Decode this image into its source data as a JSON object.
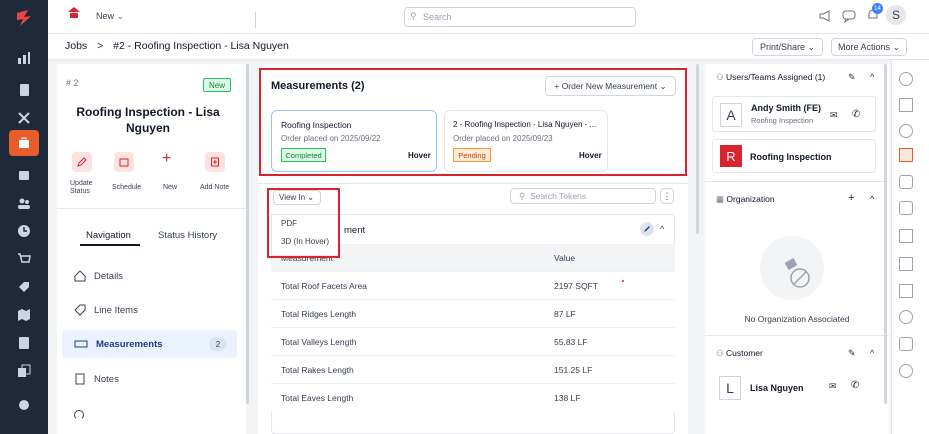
{
  "topbar": {
    "new_label": "New",
    "search_placeholder": "Search",
    "notif_count": "14",
    "avatar_initial": "S"
  },
  "breadcrumb": {
    "root": "Jobs",
    "separator": ">",
    "current": "#2 - Roofing Inspection - Lisa Nguyen"
  },
  "actions": {
    "print_share": "Print/Share",
    "more_actions": "More Actions"
  },
  "job": {
    "number": "# 2",
    "badge": "New",
    "title": "Roofing Inspection - Lisa Nguyen",
    "quick_actions": [
      {
        "label": "Update Status"
      },
      {
        "label": "Schedule"
      },
      {
        "label": "New"
      },
      {
        "label": "Add Note"
      }
    ],
    "tabs": [
      "Navigation",
      "Status History"
    ],
    "nav": [
      {
        "label": "Details"
      },
      {
        "label": "Line Items"
      },
      {
        "label": "Measurements",
        "count": "2"
      },
      {
        "label": "Notes"
      }
    ]
  },
  "measurements": {
    "title": "Measurements (2)",
    "order_button": "+ Order New Measurement",
    "orders": [
      {
        "title": "Roofing Inspection",
        "date": "Order placed on 2025/09/22",
        "status": "Completed",
        "hover": "Hover"
      },
      {
        "title": "2 - Roofing Inspection - Lisa Nguyen - ...",
        "date": "Order placed on 2025/09/23",
        "status": "Pending",
        "hover": "Hover"
      }
    ],
    "view_in": "View In",
    "view_menu": [
      "PDF",
      "3D (In Hover)"
    ],
    "search_tokens": "Search Tokens",
    "section_title_suffix": "ment",
    "table_headers": [
      "Measurement",
      "Value"
    ],
    "rows": [
      {
        "name": "Total Roof Facets Area",
        "value": "2197 SQFT"
      },
      {
        "name": "Total Ridges Length",
        "value": "87 LF"
      },
      {
        "name": "Total Valleys Length",
        "value": "55.83 LF"
      },
      {
        "name": "Total Rakes Length",
        "value": "151.25 LF"
      },
      {
        "name": "Total Eaves Length",
        "value": "138 LF"
      }
    ]
  },
  "right": {
    "users_title": "Users/Teams Assigned (1)",
    "user": {
      "initial": "A",
      "name": "Andy Smith (FE)",
      "role": "Roofing Inspection"
    },
    "team": {
      "initial": "R",
      "name": "Roofing Inspection"
    },
    "org_title": "Organization",
    "org_empty": "No Organization Associated",
    "customer_title": "Customer",
    "customer": {
      "initial": "L",
      "name": "Lisa Nguyen"
    }
  },
  "colors": {
    "rail": "#1e2a3a",
    "accent": "#e85d2a",
    "highlight": "#d9232e",
    "link": "#1e3a8a"
  }
}
